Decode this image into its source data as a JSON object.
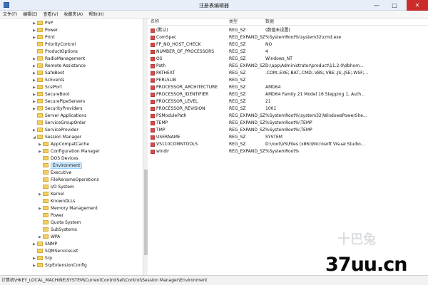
{
  "window": {
    "title": "注册表编辑器",
    "minimize": "—",
    "maximize": "□",
    "close": "✕"
  },
  "menu": [
    "文件(F)",
    "编辑(E)",
    "查看(V)",
    "收藏夹(A)",
    "帮助(H)"
  ],
  "tree": [
    {
      "label": "PnP",
      "expander": "▶",
      "level": 0
    },
    {
      "label": "Power",
      "expander": "▶",
      "level": 0
    },
    {
      "label": "Print",
      "expander": "▶",
      "level": 0
    },
    {
      "label": "PriorityControl",
      "expander": "",
      "level": 0
    },
    {
      "label": "ProductOptions",
      "expander": "",
      "level": 0
    },
    {
      "label": "RadioManagement",
      "expander": "▶",
      "level": 0
    },
    {
      "label": "Remote Assistance",
      "expander": "▶",
      "level": 0
    },
    {
      "label": "SafeBoot",
      "expander": "▶",
      "level": 0
    },
    {
      "label": "ScEvents",
      "expander": "▶",
      "level": 0
    },
    {
      "label": "ScsiPort",
      "expander": "▶",
      "level": 0
    },
    {
      "label": "SecureBoot",
      "expander": "▶",
      "level": 0
    },
    {
      "label": "SecurePipeServers",
      "expander": "▶",
      "level": 0
    },
    {
      "label": "SecurityProviders",
      "expander": "▶",
      "level": 0
    },
    {
      "label": "Server Applications",
      "expander": "",
      "level": 0
    },
    {
      "label": "ServiceGroupOrder",
      "expander": "",
      "level": 0
    },
    {
      "label": "ServiceProvider",
      "expander": "▶",
      "level": 0
    },
    {
      "label": "Session Manager",
      "expander": "◢",
      "level": 0
    },
    {
      "label": "AppCompatCache",
      "expander": "▶",
      "level": 1
    },
    {
      "label": "Configuration Manager",
      "expander": "▶",
      "level": 1
    },
    {
      "label": "DOS Devices",
      "expander": "",
      "level": 1
    },
    {
      "label": "Environment",
      "expander": "",
      "level": 1,
      "selected": true
    },
    {
      "label": "Executive",
      "expander": "",
      "level": 1
    },
    {
      "label": "FileRenameOperations",
      "expander": "",
      "level": 1
    },
    {
      "label": "I/O System",
      "expander": "",
      "level": 1
    },
    {
      "label": "Kernel",
      "expander": "▶",
      "level": 1
    },
    {
      "label": "KnownDLLs",
      "expander": "",
      "level": 1
    },
    {
      "label": "Memory Management",
      "expander": "▶",
      "level": 1
    },
    {
      "label": "Power",
      "expander": "",
      "level": 1
    },
    {
      "label": "Quota System",
      "expander": "",
      "level": 1
    },
    {
      "label": "SubSystems",
      "expander": "",
      "level": 1
    },
    {
      "label": "WPA",
      "expander": "▶",
      "level": 1
    },
    {
      "label": "SNMP",
      "expander": "▶",
      "level": 0
    },
    {
      "label": "SQMServiceList",
      "expander": "",
      "level": 0
    },
    {
      "label": "Srp",
      "expander": "▶",
      "level": 0
    },
    {
      "label": "SrpExtensionConfig",
      "expander": "▶",
      "level": 0
    }
  ],
  "columns": {
    "name": "名称",
    "type": "类型",
    "data": "数据"
  },
  "values": [
    {
      "name": "(默认)",
      "type": "REG_SZ",
      "data": "(数值未设置)"
    },
    {
      "name": "ComSpec",
      "type": "REG_EXPAND_SZ",
      "data": "%SystemRoot%\\system32\\cmd.exe"
    },
    {
      "name": "FP_NO_HOST_CHECK",
      "type": "REG_SZ",
      "data": "NO"
    },
    {
      "name": "NUMBER_OF_PROCESSORS",
      "type": "REG_SZ",
      "data": "4"
    },
    {
      "name": "OS",
      "type": "REG_SZ",
      "data": "Windows_NT"
    },
    {
      "name": "Path",
      "type": "REG_EXPAND_SZ",
      "data": "D:\\app\\Administrator\\product\\11.2.0\\dbhom..."
    },
    {
      "name": "PATHEXT",
      "type": "REG_SZ",
      "data": ".COM;.EXE;.BAT;.CMD;.VBS;.VBE;.JS;.JSE;.WSF;..."
    },
    {
      "name": "PERL5LIB",
      "type": "REG_SZ",
      "data": ""
    },
    {
      "name": "PROCESSOR_ARCHITECTURE",
      "type": "REG_SZ",
      "data": "AMD64"
    },
    {
      "name": "PROCESSOR_IDENTIFIER",
      "type": "REG_SZ",
      "data": "AMD64 Family 21 Model 16 Stepping 1, Auth..."
    },
    {
      "name": "PROCESSOR_LEVEL",
      "type": "REG_SZ",
      "data": "21"
    },
    {
      "name": "PROCESSOR_REVISION",
      "type": "REG_SZ",
      "data": "1001"
    },
    {
      "name": "PSModulePath",
      "type": "REG_EXPAND_SZ",
      "data": "%SystemRoot%\\system32\\WindowsPowerShe..."
    },
    {
      "name": "TEMP",
      "type": "REG_EXPAND_SZ",
      "data": "%SystemRoot%\\TEMP"
    },
    {
      "name": "TMP",
      "type": "REG_EXPAND_SZ",
      "data": "%SystemRoot%\\TEMP"
    },
    {
      "name": "USERNAME",
      "type": "REG_SZ",
      "data": "SYSTEM"
    },
    {
      "name": "VS110COMNTOOLS",
      "type": "REG_SZ",
      "data": "D:\\root\\VS\\Files (x86)\\Microsoft Visual Studio..."
    },
    {
      "name": "windir",
      "type": "REG_EXPAND_SZ",
      "data": "%SystemRoot%"
    }
  ],
  "status": "计算机\\HKEY_LOCAL_MACHINE\\SYSTEM\\CurrentControlSet\\Control\\Session Manager\\Environment",
  "watermark": {
    "top": "十巴兔",
    "main": "37uu.cn"
  }
}
